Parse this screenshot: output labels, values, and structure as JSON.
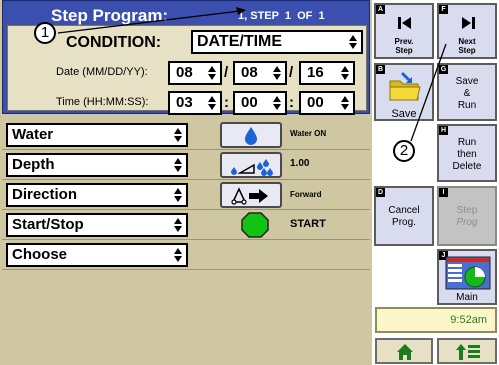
{
  "header": {
    "title": "Step Program:",
    "step_counter": "1, STEP  1  OF  1"
  },
  "condition": {
    "label": "CONDITION:",
    "value": "DATE/TIME"
  },
  "date": {
    "label": "Date (MM/DD/YY):",
    "month": "08",
    "day": "08",
    "year": "16",
    "sep": "/"
  },
  "time": {
    "label": "Time (HH:MM:SS):",
    "hours": "03",
    "minutes": "00",
    "seconds": "00",
    "sep": ":"
  },
  "actions": [
    {
      "label": "Water",
      "icon": "water-drop-icon",
      "value": "Water ON"
    },
    {
      "label": "Depth",
      "icon": "depth-droplets-icon",
      "value": "1.00"
    },
    {
      "label": "Direction",
      "icon": "direction-arrow-icon",
      "value": "Forward"
    },
    {
      "label": "Start/Stop",
      "icon": "start-stop-icon",
      "value": "START"
    },
    {
      "label": "Choose",
      "icon": "",
      "value": ""
    }
  ],
  "side_buttons": {
    "prev": {
      "tag": "A",
      "label_1": "Prev.",
      "label_2": "Step"
    },
    "next": {
      "tag": "F",
      "label_1": "Next",
      "label_2": "Step"
    },
    "save": {
      "tag": "B",
      "label": "Save"
    },
    "save_run": {
      "tag": "G",
      "label_1": "Save",
      "label_2": "&",
      "label_3": "Run"
    },
    "run_delete": {
      "tag": "H",
      "label_1": "Run",
      "label_2": "then",
      "label_3": "Delete"
    },
    "cancel": {
      "tag": "D",
      "label_1": "Cancel",
      "label_2": "Prog."
    },
    "step_prog": {
      "tag": "I",
      "label_1": "Step",
      "label_2": "Prog"
    },
    "main": {
      "tag": "J",
      "label": "Main"
    }
  },
  "clock": "9:52am",
  "callouts": [
    "1",
    "2"
  ],
  "colors": {
    "header_blue": "#3a4fae",
    "panel_tan": "#cfc7a2",
    "button_lavender": "#d9dcef",
    "start_green": "#12c412"
  }
}
